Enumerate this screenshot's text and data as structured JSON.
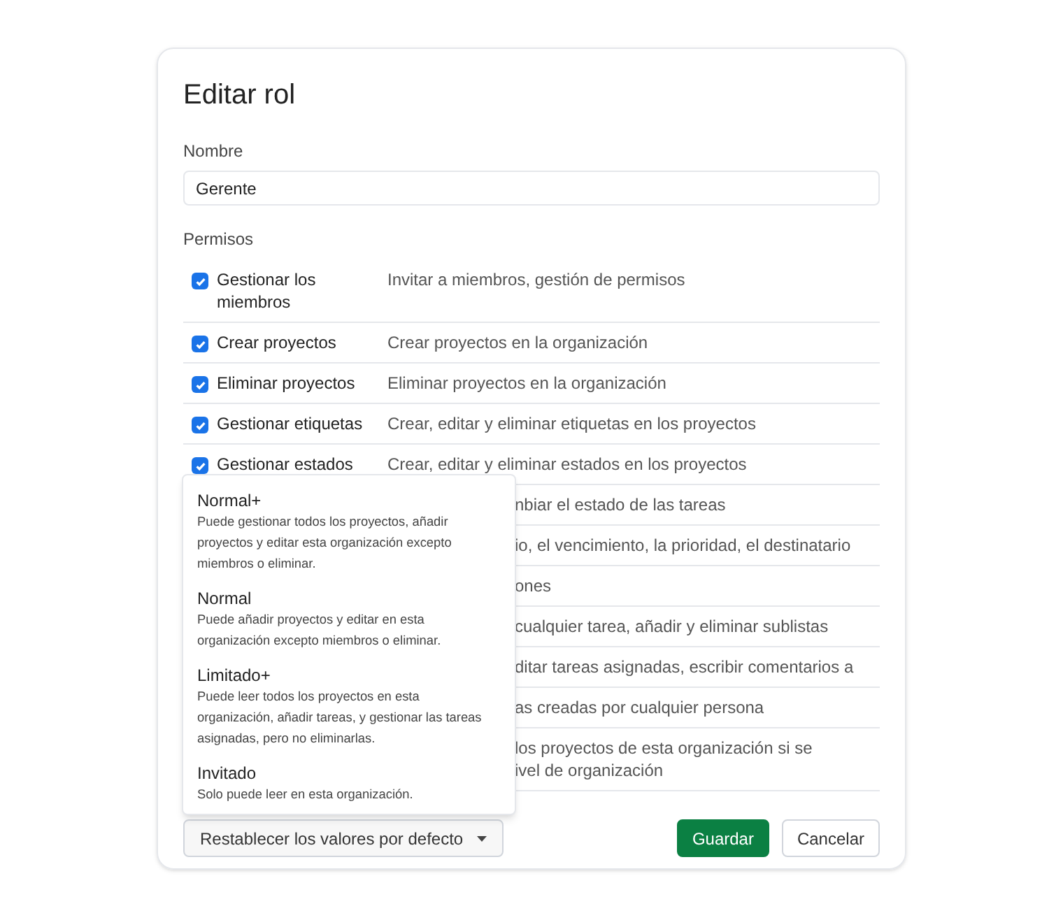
{
  "dialog": {
    "title": "Editar rol"
  },
  "name_field": {
    "label": "Nombre",
    "value": "Gerente"
  },
  "permissions": {
    "label": "Permisos",
    "rows": [
      {
        "kind": "full",
        "label": "Gestionar los miembros",
        "description": "Invitar a miembros, gestión de permisos",
        "checked": true
      },
      {
        "kind": "full",
        "label": "Crear proyectos",
        "description": "Crear proyectos en la organización",
        "checked": true
      },
      {
        "kind": "full",
        "label": "Eliminar proyectos",
        "description": "Eliminar proyectos en la organización",
        "checked": true
      },
      {
        "kind": "full",
        "label": "Gestionar etiquetas",
        "description": "Crear, editar y eliminar etiquetas en los proyectos",
        "checked": true
      },
      {
        "kind": "full",
        "label": "Gestionar estados",
        "description": "Crear, editar y eliminar estados en los proyectos",
        "checked": true
      },
      {
        "kind": "covered",
        "description": "nbiar el estado de las tareas"
      },
      {
        "kind": "covered",
        "description": "io, el vencimiento, la prioridad, el destinatario"
      },
      {
        "kind": "covered",
        "description": "ones"
      },
      {
        "kind": "covered",
        "description": "cualquier tarea, añadir y eliminar sublistas"
      },
      {
        "kind": "covered",
        "description": "ditar tareas asignadas, escribir comentarios a"
      },
      {
        "kind": "covered",
        "description": "as creadas por cualquier persona"
      },
      {
        "kind": "covered_multiline",
        "lines": [
          "los proyectos de esta organización si se",
          "ivel de organización"
        ]
      }
    ]
  },
  "preset_menu": {
    "items": [
      {
        "title": "Normal+",
        "description": "Puede gestionar todos los proyectos, añadir proyectos y editar esta organización excepto miembros o eliminar."
      },
      {
        "title": "Normal",
        "description": "Puede añadir proyectos y editar en esta organización excepto miembros o eliminar."
      },
      {
        "title": "Limitado+",
        "description": "Puede leer todos los proyectos en esta organización, añadir tareas, y gestionar las tareas asignadas, pero no eliminarlas."
      },
      {
        "title": "Invitado",
        "description": "Solo puede leer en esta organización."
      }
    ]
  },
  "reset_button": {
    "label": "Restablecer los valores por defecto"
  },
  "buttons": [
    {
      "kind": "primary",
      "label": "Guardar"
    },
    {
      "kind": "secondary",
      "label": "Cancelar"
    }
  ]
}
